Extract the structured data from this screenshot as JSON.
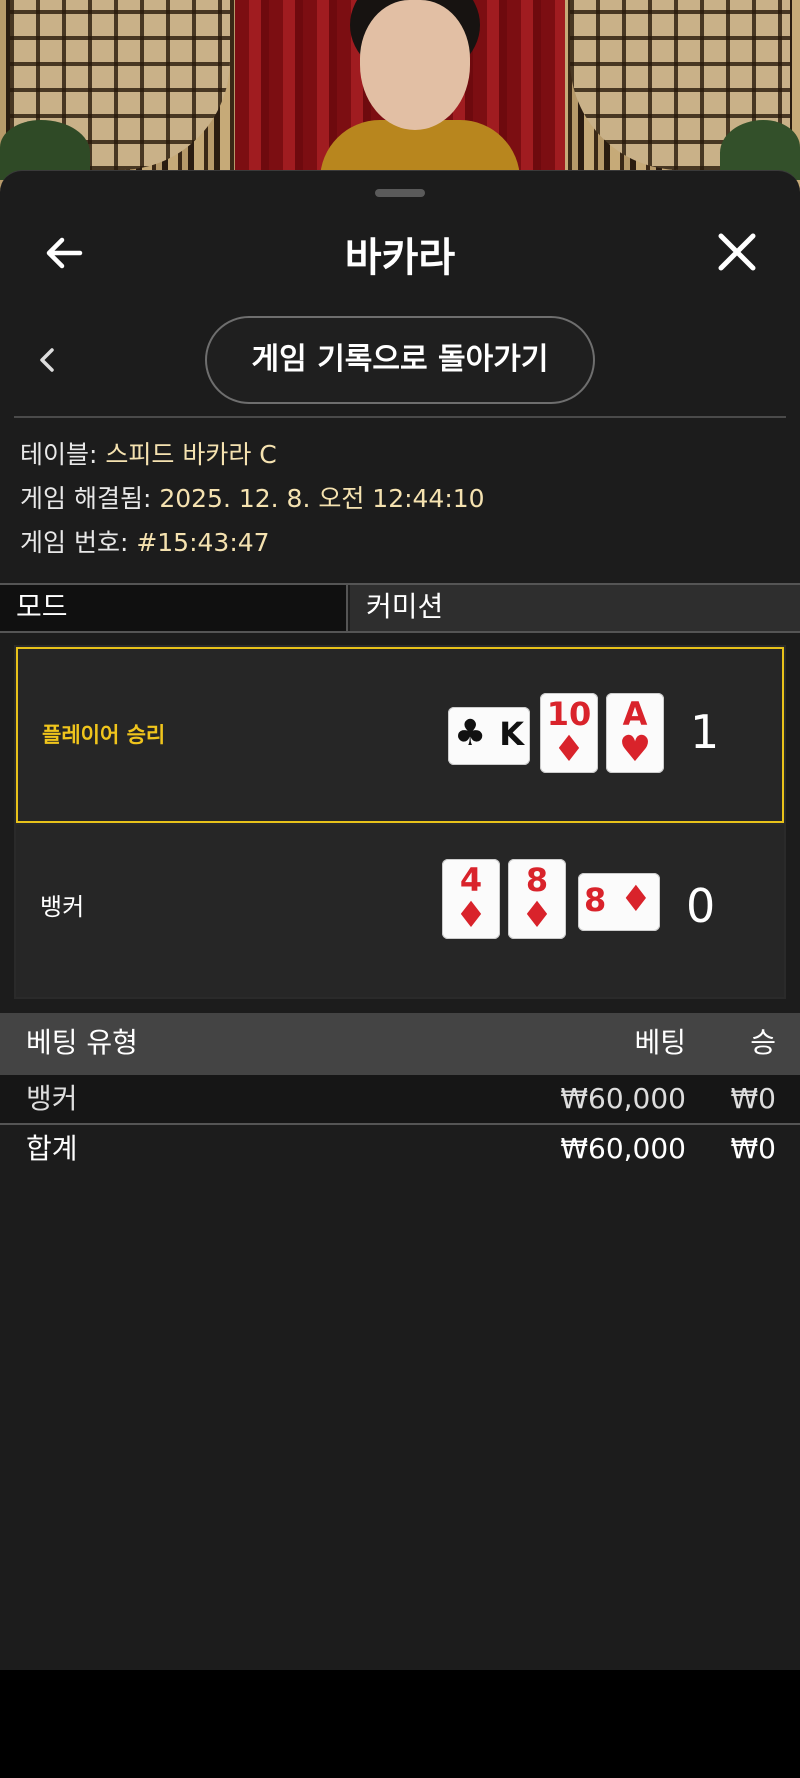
{
  "header": {
    "title": "바카라"
  },
  "nav": {
    "back_to_history_label": "게임 기록으로 돌아가기"
  },
  "info": {
    "table_label": "테이블:",
    "table_value": "스피드 바카라 C",
    "resolved_label": "게임 해결됨:",
    "resolved_value": "2025. 12. 8. 오전 12:44:10",
    "game_no_label": "게임 번호:",
    "game_no_value": "#15:43:47"
  },
  "mode": {
    "label": "모드",
    "value": "커미션"
  },
  "result": {
    "player": {
      "label": "플레이어 승리",
      "score": "1",
      "cards": [
        {
          "rank": "K",
          "suit": "♣",
          "color": "#111111",
          "orientation": "horizontal"
        },
        {
          "rank": "10",
          "suit": "♦",
          "color": "#d9232b",
          "orientation": "vertical"
        },
        {
          "rank": "A",
          "suit": "♥",
          "color": "#d9232b",
          "orientation": "vertical"
        }
      ]
    },
    "banker": {
      "label": "뱅커",
      "score": "0",
      "cards": [
        {
          "rank": "4",
          "suit": "♦",
          "color": "#d9232b",
          "orientation": "vertical"
        },
        {
          "rank": "8",
          "suit": "♦",
          "color": "#d9232b",
          "orientation": "vertical"
        },
        {
          "rank": "8",
          "suit": "♦",
          "color": "#d9232b",
          "orientation": "horizontal"
        }
      ]
    },
    "highlight_color": "#e8c21a"
  },
  "bets": {
    "headers": {
      "type": "베팅 유형",
      "bet": "베팅",
      "win": "승"
    },
    "rows": [
      {
        "type": "뱅커",
        "bet": "₩60,000",
        "win": "₩0"
      }
    ],
    "total": {
      "type": "합계",
      "bet": "₩60,000",
      "win": "₩0"
    }
  },
  "icons": {
    "back": "arrow-left-icon",
    "close": "close-icon",
    "prev": "chevron-left-icon"
  }
}
